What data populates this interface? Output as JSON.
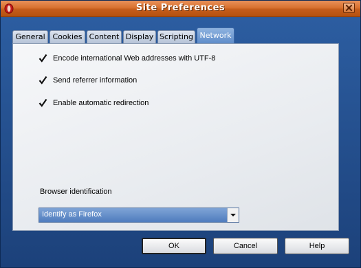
{
  "window": {
    "title": "Site Preferences"
  },
  "tabs": [
    {
      "label": "General"
    },
    {
      "label": "Cookies"
    },
    {
      "label": "Content"
    },
    {
      "label": "Display"
    },
    {
      "label": "Scripting"
    },
    {
      "label": "Network",
      "active": true
    }
  ],
  "options": [
    {
      "label": "Encode international Web addresses with UTF-8",
      "checked": true
    },
    {
      "label": "Send referrer information",
      "checked": true
    },
    {
      "label": "Enable automatic redirection",
      "checked": true
    }
  ],
  "browser_identification": {
    "label": "Browser identification",
    "selected": "Identify as Firefox"
  },
  "buttons": {
    "ok": "OK",
    "cancel": "Cancel",
    "help": "Help"
  },
  "colors": {
    "titlebar": "#d8712f",
    "frame": "#2d5fa3",
    "active_tab": "#5d8bc9",
    "select_highlight": "#4f7cbe"
  }
}
